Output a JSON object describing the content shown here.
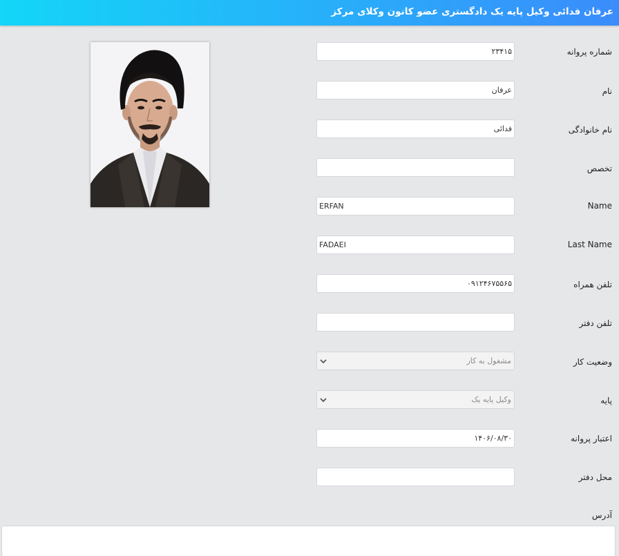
{
  "header": {
    "title": "عرفان فدائی وکیل پایه یک دادگستری عضو کانون وکلای مرکز"
  },
  "form": {
    "license_number": {
      "label": "شماره پروانه",
      "value": "۲۳۴۱۵"
    },
    "first_name": {
      "label": "نام",
      "value": "عرفان"
    },
    "last_name": {
      "label": "نام خانوادگی",
      "value": "فدائی"
    },
    "specialty": {
      "label": "تخصص",
      "value": ""
    },
    "name_en": {
      "label": "Name",
      "value": "ERFAN"
    },
    "last_name_en": {
      "label": "Last Name",
      "value": "FADAEI"
    },
    "mobile": {
      "label": "تلفن همراه",
      "value": "۰۹۱۲۴۶۷۵۵۶۵"
    },
    "office_phone": {
      "label": "تلفن دفتر",
      "value": ""
    },
    "work_status": {
      "label": "وضعیت کار",
      "selected": "مشغول به کار"
    },
    "grade": {
      "label": "پایه",
      "selected": "وکیل پایه یک"
    },
    "license_validity": {
      "label": "اعتبار پروانه",
      "value": "۱۴۰۶/۰۸/۳۰"
    },
    "office_location": {
      "label": "محل دفتر",
      "value": ""
    },
    "address": {
      "label": "آدرس",
      "value": ""
    }
  },
  "icons": {
    "select_arrow": "chevron-down-icon"
  },
  "colors": {
    "header_start": "#13d6f8",
    "header_end": "#3a8cfb",
    "page_bg": "#e6e7e9"
  }
}
